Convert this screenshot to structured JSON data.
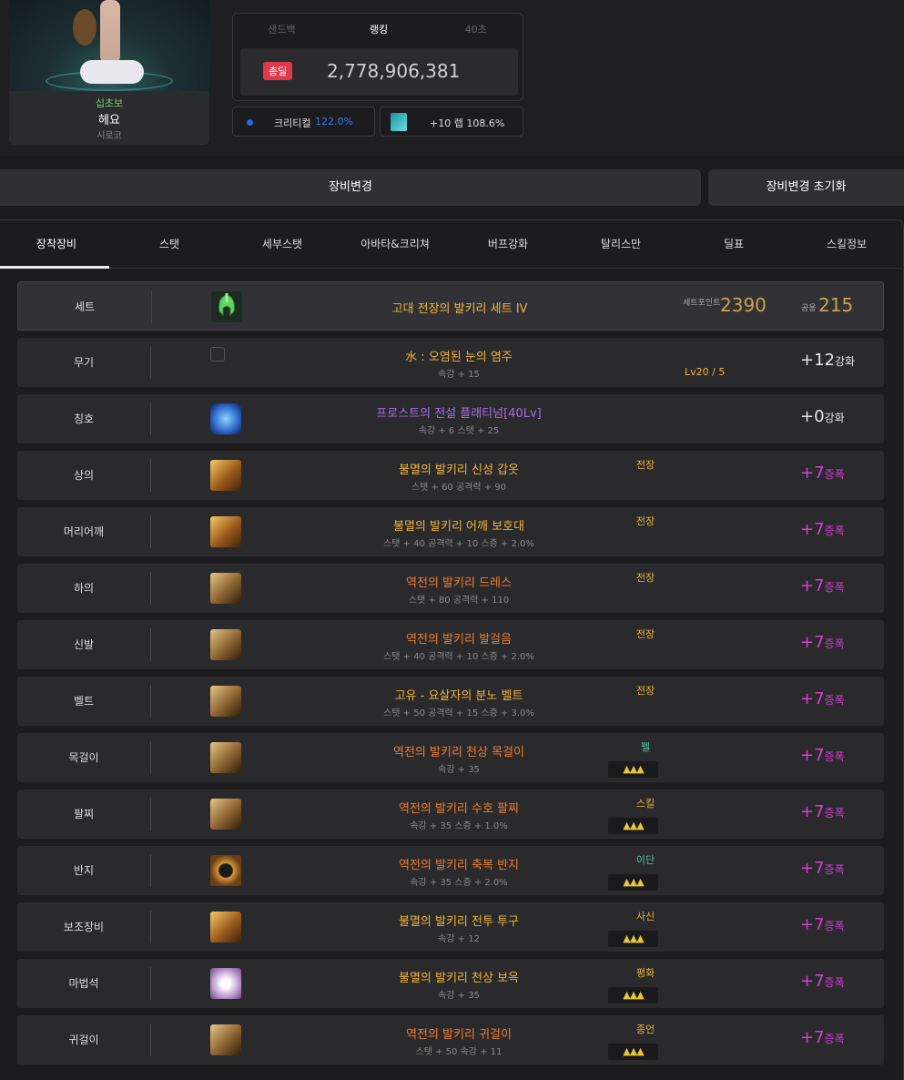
{
  "character": {
    "class": "십초보",
    "name": "헤요",
    "server": "시로코"
  },
  "ranking": {
    "tabs": [
      "샌드백",
      "랭킹",
      "40초"
    ],
    "active_tab": "랭킹",
    "badge": "총딜",
    "value": "2,778,906,381"
  },
  "stats": {
    "critical_label": "크리티컬",
    "critical_value": "122.0%",
    "level_label": "+10 렙 108.6%"
  },
  "buttons": {
    "change": "장비변경",
    "reset": "장비변경 초기화"
  },
  "tabs": [
    "장착장비",
    "스탯",
    "세부스탯",
    "아바타&크리쳐",
    "버프강화",
    "탈리스만",
    "딜표",
    "스킬정보"
  ],
  "active_tab": "장착장비",
  "set_row": {
    "slot": "세트",
    "name": "고대 전장의 발키리 세트 IV",
    "point_label": "세트포인트",
    "point_value": "2390",
    "common_label": "공용",
    "common_value": "215"
  },
  "equipment": [
    {
      "slot": "무기",
      "name": "水 : 오염된 눈의 염주",
      "sub": "속강 + 15",
      "rarity": "legend",
      "extra": "Lv20 / 5",
      "enh_value": "+12",
      "enh_unit": "강화",
      "enh_color": "white",
      "icon": "weapon"
    },
    {
      "slot": "칭호",
      "name": "프로스트의 전설 플래티넘[40Lv]",
      "sub": "속강 + 6 스탯 + 25",
      "rarity": "purple",
      "enh_value": "+0",
      "enh_unit": "강화",
      "enh_color": "white",
      "icon": "title"
    },
    {
      "slot": "상의",
      "name": "불멸의 발키리 신성 갑옷",
      "sub": "스탯 + 60 공격력 + 90",
      "rarity": "legend",
      "tag": "전장",
      "tag_color": "legend",
      "enh_value": "+7",
      "enh_unit": "증폭",
      "enh_color": "magenta",
      "icon": "gold"
    },
    {
      "slot": "머리어깨",
      "name": "불멸의 발키리 어깨 보호대",
      "sub": "스탯 + 40 공격력 + 10 스증 + 2.0%",
      "rarity": "legend",
      "tag": "전장",
      "tag_color": "legend",
      "enh_value": "+7",
      "enh_unit": "증폭",
      "enh_color": "magenta",
      "icon": "gold"
    },
    {
      "slot": "하의",
      "name": "역전의 발키리 드레스",
      "sub": "스탯 + 80 공격력 + 110",
      "rarity": "epic",
      "tag": "전장",
      "tag_color": "legend",
      "enh_value": "+7",
      "enh_unit": "증폭",
      "enh_color": "magenta",
      "icon": "bronze"
    },
    {
      "slot": "신발",
      "name": "역전의 발키리 발걸음",
      "sub": "스탯 + 40 공격력 + 10 스증 + 2.0%",
      "rarity": "epic",
      "tag": "전장",
      "tag_color": "legend",
      "enh_value": "+7",
      "enh_unit": "증폭",
      "enh_color": "magenta",
      "icon": "bronze"
    },
    {
      "slot": "벨트",
      "name": "고유 - 요살자의 분노 벨트",
      "sub": "스탯 + 50 공격력 + 15 스증 + 3.0%",
      "rarity": "legend",
      "tag": "전장",
      "tag_color": "legend",
      "enh_value": "+7",
      "enh_unit": "증폭",
      "enh_color": "magenta",
      "icon": "bronze"
    },
    {
      "slot": "목걸이",
      "name": "역전의 발키리 천상 목걸이",
      "sub": "속강 + 35",
      "rarity": "epic",
      "tag": "펠",
      "tag_color": "green",
      "stars": "▲▲▲",
      "enh_value": "+7",
      "enh_unit": "증폭",
      "enh_color": "magenta",
      "icon": "bronze"
    },
    {
      "slot": "팔찌",
      "name": "역전의 발키리 수호 팔찌",
      "sub": "속강 + 35 스증 + 1.0%",
      "rarity": "epic",
      "tag": "스킬",
      "tag_color": "legend",
      "stars": "▲▲▲",
      "enh_value": "+7",
      "enh_unit": "증폭",
      "enh_color": "magenta",
      "icon": "bronze"
    },
    {
      "slot": "반지",
      "name": "역전의 발키리 축복 반지",
      "sub": "속강 + 35 스증 + 2.0%",
      "rarity": "epic",
      "tag": "이단",
      "tag_color": "green",
      "stars": "▲▲▲",
      "enh_value": "+7",
      "enh_unit": "증폭",
      "enh_color": "magenta",
      "icon": "ring"
    },
    {
      "slot": "보조장비",
      "name": "불멸의 발키리 전투 투구",
      "sub": "속강 + 12",
      "rarity": "legend",
      "tag": "사신",
      "tag_color": "legend",
      "stars": "▲▲▲",
      "enh_value": "+7",
      "enh_unit": "증폭",
      "enh_color": "magenta",
      "icon": "gold"
    },
    {
      "slot": "마법석",
      "name": "불멸의 발키리 천상 보옥",
      "sub": "속강 + 35",
      "rarity": "legend",
      "tag": "평화",
      "tag_color": "legend",
      "stars": "▲▲▲",
      "enh_value": "+7",
      "enh_unit": "증폭",
      "enh_color": "magenta",
      "icon": "magic"
    },
    {
      "slot": "귀걸이",
      "name": "역전의 발키리 귀걸이",
      "sub": "스탯 + 50 속강 + 11",
      "rarity": "epic",
      "tag": "종언",
      "tag_color": "legend",
      "stars": "▲▲▲",
      "enh_value": "+7",
      "enh_unit": "증폭",
      "enh_color": "magenta",
      "icon": "bronze"
    }
  ]
}
